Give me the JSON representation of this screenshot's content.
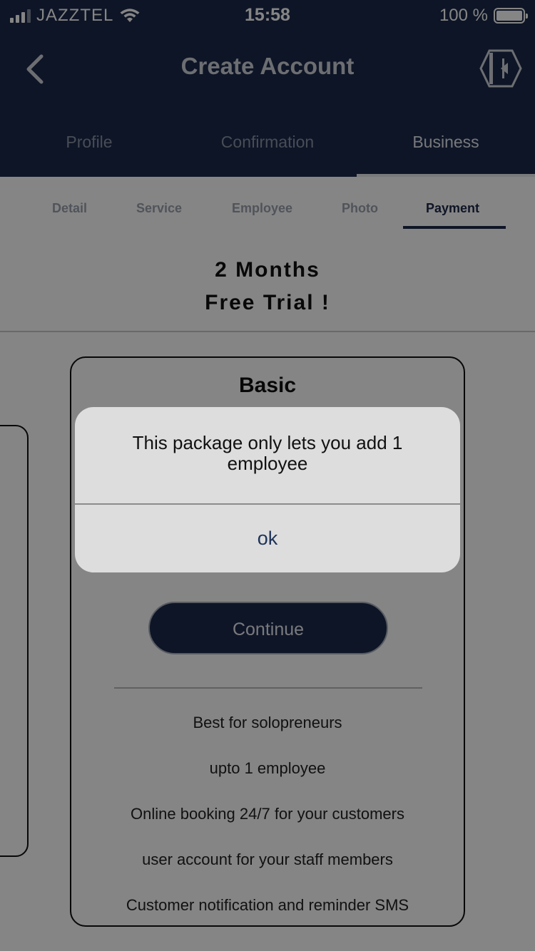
{
  "status_bar": {
    "carrier": "JAZZTEL",
    "time": "15:58",
    "battery": "100 %"
  },
  "nav": {
    "title": "Create Account",
    "back_icon": "chevron-left-icon",
    "logo_icon": "hexagon-logo-icon"
  },
  "main_tabs": [
    {
      "label": "Profile",
      "active": false
    },
    {
      "label": "Confirmation",
      "active": false
    },
    {
      "label": "Business",
      "active": true
    }
  ],
  "sub_tabs": [
    {
      "label": "Detail",
      "active": false
    },
    {
      "label": "Service",
      "active": false
    },
    {
      "label": "Employee",
      "active": false
    },
    {
      "label": "Photo",
      "active": false
    },
    {
      "label": "Payment",
      "active": true
    }
  ],
  "trial": {
    "line1": "2 Months",
    "line2": "Free Trial !"
  },
  "plan": {
    "title": "Basic",
    "continue_label": "Continue",
    "features": [
      "Best for solopreneurs",
      "upto 1 employee",
      "Online booking 24/7 for your customers",
      "user account for your staff members",
      "Customer notification and reminder SMS"
    ]
  },
  "alert": {
    "message": "This package only lets you add 1 employee",
    "button_label": "ok"
  },
  "colors": {
    "primary": "#1b2a4a",
    "alert_bg": "#dddddd",
    "alert_button": "#1f3359"
  }
}
